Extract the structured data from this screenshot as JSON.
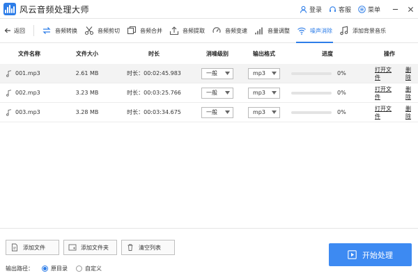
{
  "app": {
    "title": "风云音频处理大师"
  },
  "titlebar": {
    "login": "登录",
    "support": "客服",
    "menu": "菜单"
  },
  "toolbar": {
    "back": "返回",
    "tools": [
      "音频转换",
      "音频剪切",
      "音频合并",
      "音频提取",
      "音频变速",
      "音量调整",
      "噪声消除",
      "添加背景音乐"
    ],
    "active_index": 6
  },
  "table": {
    "headers": [
      "文件名称",
      "文件大小",
      "时长",
      "消噪级别",
      "输出格式",
      "进度",
      "操作"
    ],
    "duration_prefix": "时长：",
    "open_label": "打开文件",
    "delete_label": "删除",
    "rows": [
      {
        "name": "001.mp3",
        "size": "2.61 MB",
        "duration": "00:02:45.983",
        "level": "一般",
        "format": "mp3",
        "progress": 0,
        "progress_text": "0%"
      },
      {
        "name": "002.mp3",
        "size": "3.23 MB",
        "duration": "00:03:25.766",
        "level": "一般",
        "format": "mp3",
        "progress": 0,
        "progress_text": "0%"
      },
      {
        "name": "003.mp3",
        "size": "3.28 MB",
        "duration": "00:03:34.675",
        "level": "一般",
        "format": "mp3",
        "progress": 0,
        "progress_text": "0%"
      }
    ]
  },
  "bottom": {
    "add_file": "添加文件",
    "add_folder": "添加文件夹",
    "clear_list": "清空列表",
    "output_label": "输出路径：",
    "option_original": "原目录",
    "option_custom": "自定义",
    "start": "开始处理"
  },
  "colors": {
    "accent": "#2d7de8",
    "start_button": "#3d8af2"
  }
}
